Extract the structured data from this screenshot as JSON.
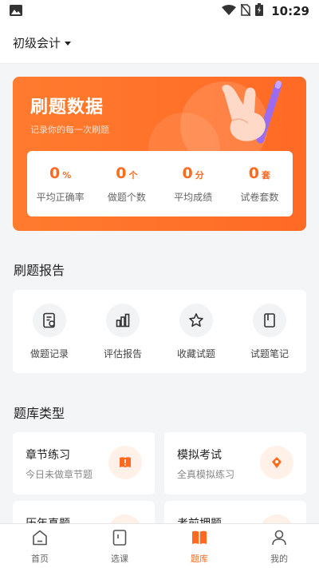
{
  "status_bar": {
    "time": "10:29"
  },
  "header": {
    "course": "初级会计"
  },
  "banner": {
    "title": "刷题数据",
    "subtitle": "记录你的每一次刷题",
    "stats": [
      {
        "value": "0",
        "unit": "%",
        "label": "平均正确率"
      },
      {
        "value": "0",
        "unit": "个",
        "label": "做题个数"
      },
      {
        "value": "0",
        "unit": "分",
        "label": "平均成绩"
      },
      {
        "value": "0",
        "unit": "套",
        "label": "试卷套数"
      }
    ]
  },
  "report": {
    "title": "刷题报告",
    "items": [
      {
        "label": "做题记录",
        "icon": "record-icon"
      },
      {
        "label": "评估报告",
        "icon": "bar-chart-icon"
      },
      {
        "label": "收藏试题",
        "icon": "star-icon"
      },
      {
        "label": "试题笔记",
        "icon": "notebook-icon"
      }
    ]
  },
  "bank": {
    "title": "题库类型",
    "items": [
      {
        "title": "章节练习",
        "subtitle": "今日未做章节题",
        "icon": "book-icon"
      },
      {
        "title": "模拟考试",
        "subtitle": "全真模拟练习",
        "icon": "pen-nib-icon"
      },
      {
        "title": "历年真题",
        "subtitle": "",
        "icon": ""
      },
      {
        "title": "考前押题",
        "subtitle": "",
        "icon": ""
      }
    ]
  },
  "nav": {
    "items": [
      {
        "label": "首页",
        "icon": "home-icon"
      },
      {
        "label": "选课",
        "icon": "course-icon"
      },
      {
        "label": "题库",
        "icon": "question-bank-icon",
        "active": true
      },
      {
        "label": "我的",
        "icon": "profile-icon"
      }
    ]
  },
  "colors": {
    "accent": "#ff6a1f",
    "banner": "#ff7b2e",
    "background": "#f4f5f7"
  }
}
